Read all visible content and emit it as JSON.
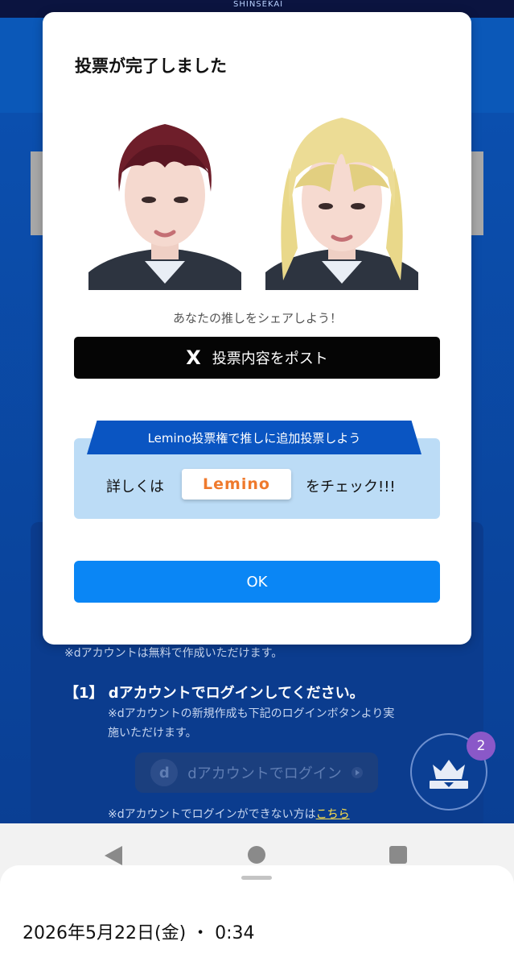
{
  "background": {
    "brand": "SHINSEKAI",
    "free_note": "※dアカウントは無料で作成いただけます。",
    "step1_label": "【1】 dアカウントでログインしてください。",
    "step1_note_line1": "※dアカウントの新規作成も下記のログインボタンより実",
    "step1_note_line2": "施いただけます。",
    "login_button_label": "dアカウントでログイン",
    "login_icon": "d",
    "cannot_login_prefix": "※dアカウントでログインができない方は",
    "cannot_login_link": "こちら",
    "fab_badge_count": "2"
  },
  "modal": {
    "title": "投票が完了しました",
    "share_prompt": "あなたの推しをシェアしよう！",
    "post_icon": "X",
    "post_button_label": "投票内容をポスト",
    "lemino_banner": "Lemino投票権で推しに追加投票しよう",
    "detail_prefix": "詳しくは",
    "lemino_logo": "Lemino",
    "detail_suffix": "をチェック!!!",
    "ok_label": "OK"
  },
  "system": {
    "datetime": "2026年5月22日(金) ・ 0:34"
  },
  "colors": {
    "accent": "#0a86f5",
    "banner": "#0a55c2",
    "lemino_box": "#bcdcf6"
  }
}
